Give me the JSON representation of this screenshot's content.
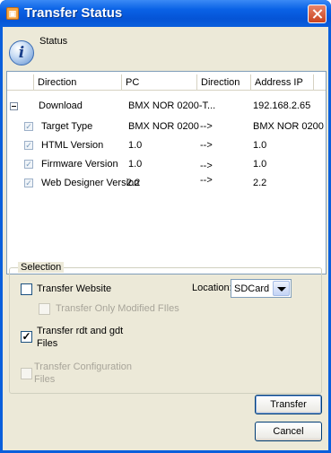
{
  "window": {
    "title": "Transfer Status"
  },
  "status": {
    "label": "Status"
  },
  "table": {
    "columns": [
      "Direction",
      "PC",
      "Direction",
      "Address IP"
    ],
    "rows": [
      {
        "direction": "Download",
        "pc": "BMX NOR 0200-T...",
        "arrow": "",
        "address": "192.168.2.65"
      },
      {
        "direction": "Target Type",
        "pc": "BMX NOR 0200",
        "arrow": "-->",
        "address": "BMX NOR 0200"
      },
      {
        "direction": "HTML Version",
        "pc": "1.0",
        "arrow": "-->",
        "address": "1.0"
      },
      {
        "direction": "Firmware Version",
        "pc": "1.0",
        "arrow": "-->",
        "address": "1.0"
      },
      {
        "direction": "Web Designer Version",
        "pc": "2.2",
        "arrow": "-->",
        "address": "2.2"
      }
    ]
  },
  "selection": {
    "label": "Selection",
    "transfer_website": "Transfer Website",
    "transfer_only_modified": "Transfer Only Modified FIles",
    "transfer_rdt_gdt_line1": "Transfer rdt and gdt",
    "transfer_rdt_gdt_line2": "Files",
    "transfer_config_line1": "Transfer Configuration",
    "transfer_config_line2": "Files",
    "check_mark": "✓",
    "location_label": "Location:",
    "location_value": "SDCard"
  },
  "buttons": {
    "transfer": "Transfer",
    "cancel": "Cancel"
  }
}
